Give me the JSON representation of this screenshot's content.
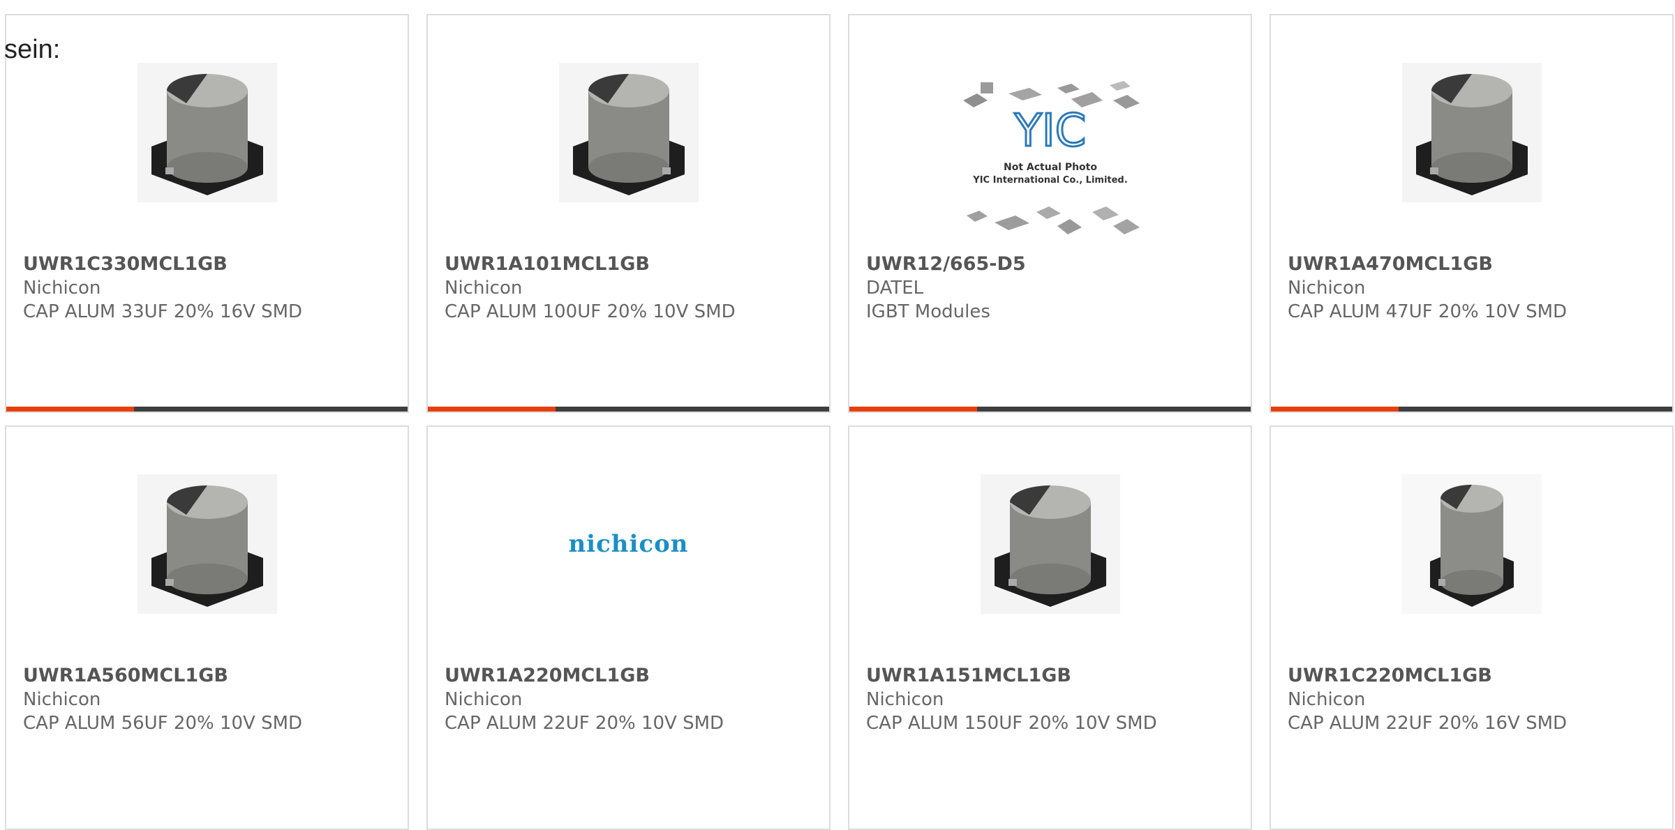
{
  "intro_text": "sein:",
  "colors": {
    "accent": "#e8400c",
    "bar": "#3e3e3e",
    "border": "#dcdcdc",
    "logo": "#1b8fc4"
  },
  "products": [
    {
      "part_number": "UWR1C330MCL1GB",
      "manufacturer": "Nichicon",
      "description": "CAP ALUM 33UF 20% 16V SMD",
      "image": "capacitor-photo"
    },
    {
      "part_number": "UWR1A101MCL1GB",
      "manufacturer": "Nichicon",
      "description": "CAP ALUM 100UF 20% 10V SMD",
      "image": "capacitor-photo"
    },
    {
      "part_number": "UWR12/665-D5",
      "manufacturer": "DATEL",
      "description": "IGBT Modules",
      "image": "placeholder-photo",
      "placeholder": {
        "logo": "YIC",
        "line1": "Not Actual Photo",
        "line2": "YIC International Co., Limited."
      }
    },
    {
      "part_number": "UWR1A470MCL1GB",
      "manufacturer": "Nichicon",
      "description": "CAP ALUM 47UF 20% 10V SMD",
      "image": "capacitor-photo"
    },
    {
      "part_number": "UWR1A560MCL1GB",
      "manufacturer": "Nichicon",
      "description": "CAP ALUM 56UF 20% 10V SMD",
      "image": "capacitor-photo"
    },
    {
      "part_number": "UWR1A220MCL1GB",
      "manufacturer": "Nichicon",
      "description": "CAP ALUM 22UF 20% 10V SMD",
      "image": "nichicon-logo",
      "logo_text": "nichicon"
    },
    {
      "part_number": "UWR1A151MCL1GB",
      "manufacturer": "Nichicon",
      "description": "CAP ALUM 150UF 20% 10V SMD",
      "image": "capacitor-photo"
    },
    {
      "part_number": "UWR1C220MCL1GB",
      "manufacturer": "Nichicon",
      "description": "CAP ALUM 22UF 20% 16V SMD",
      "image": "capacitor-photo"
    }
  ]
}
